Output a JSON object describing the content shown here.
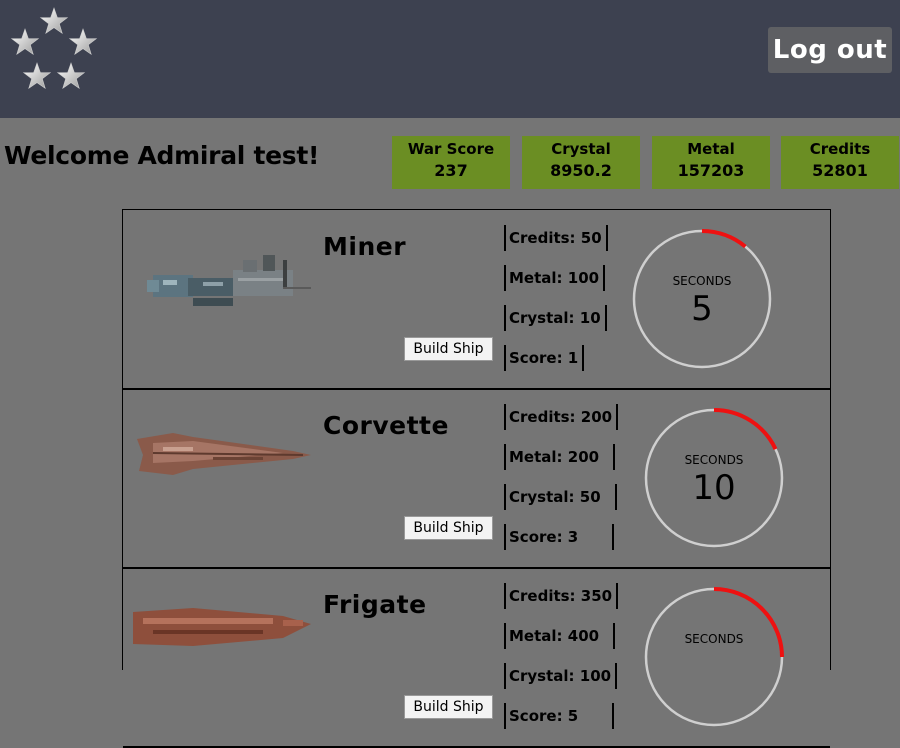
{
  "header": {
    "logout_label": "Log out",
    "logo_icon": "five-stars-icon"
  },
  "welcome_text": "Welcome Admiral test!",
  "stats": [
    {
      "label": "War Score",
      "value": "237"
    },
    {
      "label": "Crystal",
      "value": "8950.2"
    },
    {
      "label": "Metal",
      "value": "157203"
    },
    {
      "label": "Credits",
      "value": "52801"
    }
  ],
  "colors": {
    "header_bg": "#3d4150",
    "page_bg": "#757575",
    "stat_bg": "#6b8e23",
    "timer_ring": "#cfcfcf",
    "timer_progress": "#ee1111"
  },
  "ships": [
    {
      "name": "Miner",
      "build_label": "Build Ship",
      "costs": [
        "Credits: 50",
        "Metal: 100",
        "Crystal: 10",
        "Score: 1"
      ],
      "timer_label": "SECONDS",
      "timer_value": "5",
      "timer_progress": 0.11
    },
    {
      "name": "Corvette",
      "build_label": "Build Ship",
      "costs": [
        "Credits: 200",
        "Metal: 200",
        "Crystal: 50",
        "Score: 3"
      ],
      "timer_label": "SECONDS",
      "timer_value": "10",
      "timer_progress": 0.18
    },
    {
      "name": "Frigate",
      "build_label": "Build Ship",
      "costs": [
        "Credits: 350",
        "Metal: 400",
        "Crystal: 100",
        "Score: 5"
      ],
      "timer_label": "SECONDS",
      "timer_value": "",
      "timer_progress": 0.25
    }
  ]
}
